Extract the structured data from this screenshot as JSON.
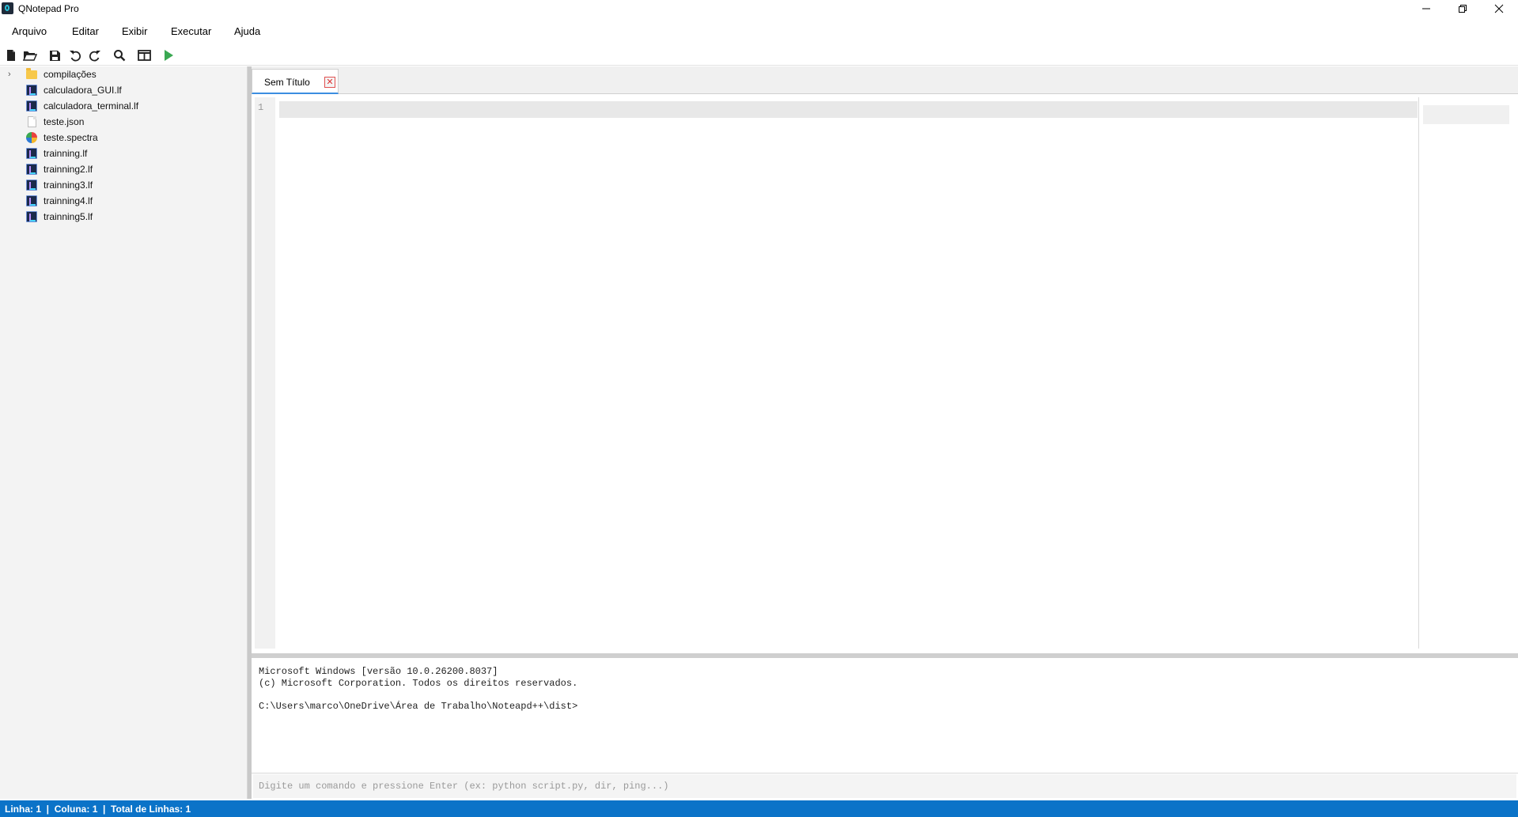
{
  "window": {
    "title": "QNotepad Pro"
  },
  "menubar": {
    "items": [
      "Arquivo",
      "Editar",
      "Exibir",
      "Executar",
      "Ajuda"
    ]
  },
  "toolbar": {
    "buttons": [
      {
        "icon": "new-file-icon"
      },
      {
        "icon": "open-folder-icon"
      },
      {
        "icon": "save-icon"
      },
      {
        "icon": "undo-icon"
      },
      {
        "icon": "redo-icon"
      },
      {
        "icon": "search-icon"
      },
      {
        "icon": "split-view-icon"
      },
      {
        "icon": "run-icon",
        "color": "#3aa852"
      }
    ]
  },
  "sidebar": {
    "items": [
      {
        "label": "compilações",
        "type": "folder",
        "collapsed": true
      },
      {
        "label": "calculadora_GUI.lf",
        "type": "lf"
      },
      {
        "label": "calculadora_terminal.lf",
        "type": "lf"
      },
      {
        "label": "teste.json",
        "type": "json"
      },
      {
        "label": "teste.spectra",
        "type": "spectra"
      },
      {
        "label": "trainning.lf",
        "type": "lf"
      },
      {
        "label": "trainning2.lf",
        "type": "lf"
      },
      {
        "label": "trainning3.lf",
        "type": "lf"
      },
      {
        "label": "trainning4.lf",
        "type": "lf"
      },
      {
        "label": "trainning5.lf",
        "type": "lf"
      }
    ]
  },
  "editor": {
    "tabs": [
      {
        "label": "Sem Título",
        "close_icon": "close-icon",
        "active": true
      }
    ],
    "line_numbers": [
      "1"
    ],
    "content": ""
  },
  "terminal": {
    "lines": [
      "Microsoft Windows [versão 10.0.26200.8037]",
      "(c) Microsoft Corporation. Todos os direitos reservados.",
      "",
      "C:\\Users\\marco\\OneDrive\\Área de Trabalho\\Noteapd++\\dist>"
    ],
    "input_placeholder": "Digite um comando e pressione Enter (ex: python script.py, dir, ping...)",
    "input_value": ""
  },
  "statusbar": {
    "text": "Linha: 1  |  Coluna: 1  |  Total de Linhas: 1"
  },
  "colors": {
    "accent": "#0b73c8",
    "run": "#3aa852",
    "tab_underline": "#3c8ee0"
  }
}
